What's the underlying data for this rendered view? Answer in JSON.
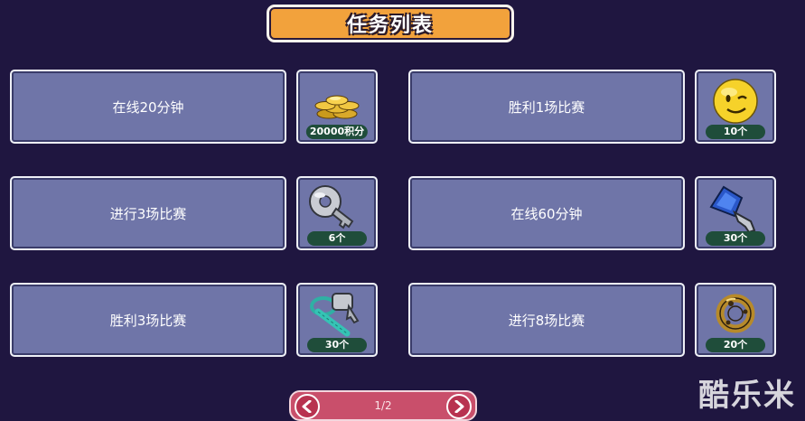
{
  "title": "任务列表",
  "tasks": [
    {
      "label": "在线20分钟",
      "reward_count": "20000积分",
      "reward_icon": "gold-coins-icon"
    },
    {
      "label": "胜利1场比赛",
      "reward_count": "10个",
      "reward_icon": "smiley-emote-icon"
    },
    {
      "label": "进行3场比赛",
      "reward_count": "6个",
      "reward_icon": "silver-key-icon"
    },
    {
      "label": "在线60分钟",
      "reward_count": "30个",
      "reward_icon": "blue-key-icon"
    },
    {
      "label": "胜利3场比赛",
      "reward_count": "30个",
      "reward_icon": "key-lanyard-icon"
    },
    {
      "label": "进行8场比赛",
      "reward_count": "20个",
      "reward_icon": "gold-ring-icon"
    }
  ],
  "pager": {
    "page": "1/2",
    "prev_icon": "chevron-left-icon",
    "next_icon": "chevron-right-icon"
  },
  "watermark": "酷乐米",
  "colors": {
    "background": "#1f1640",
    "panel": "#6f75a8",
    "title": "#f2a23c",
    "badge": "#1f4d3a",
    "pager": "#c94f6b"
  }
}
